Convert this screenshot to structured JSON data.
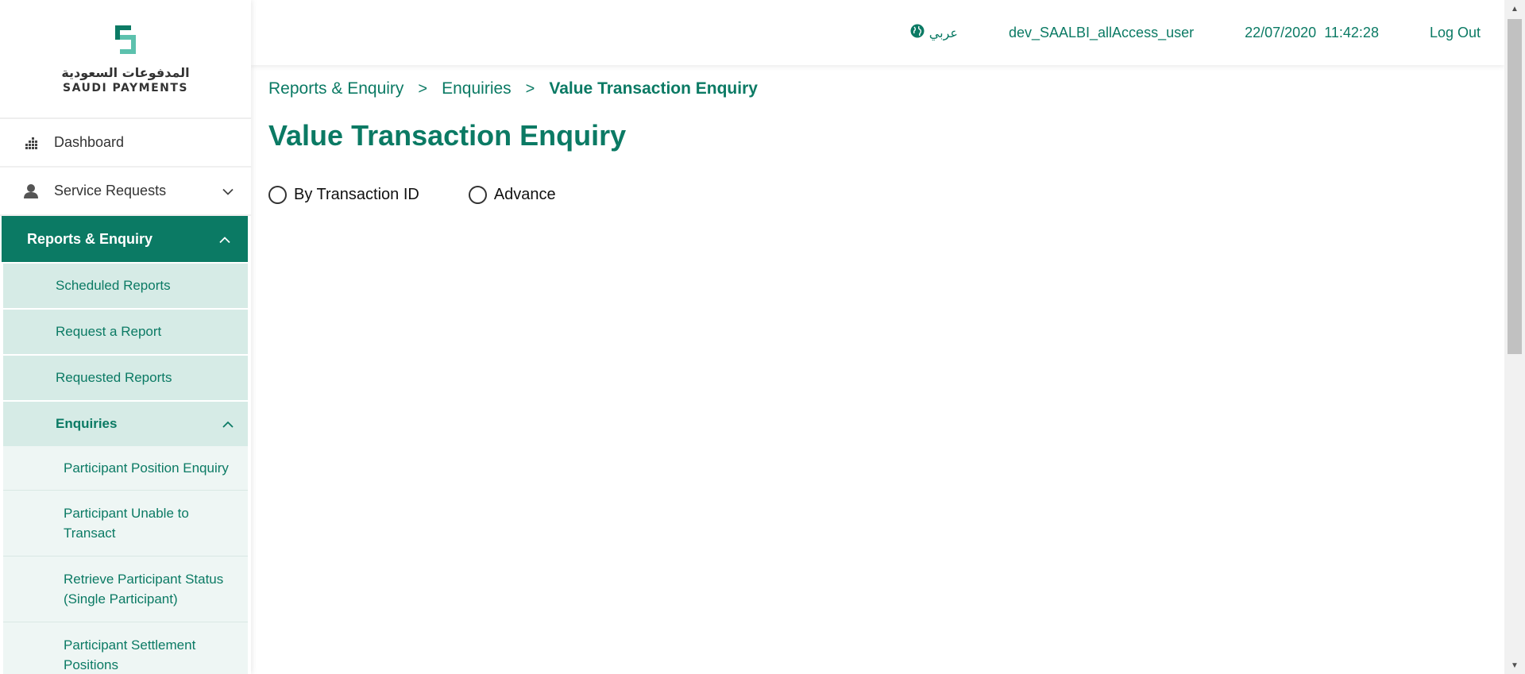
{
  "brand": {
    "name_ar": "المدفوعات السعودية",
    "name_en": "SAUDI PAYMENTS",
    "logo_icon": "saudi-payments-logo",
    "accent_color": "#0b7a64",
    "logo_light_color": "#5cc1ad"
  },
  "sidebar": {
    "items": [
      {
        "label": "Dashboard",
        "icon": "dashboard-icon"
      },
      {
        "label": "Service Requests",
        "icon": "user-icon"
      },
      {
        "label": "Reports & Enquiry"
      }
    ],
    "reports_sub": [
      {
        "label": "Scheduled Reports"
      },
      {
        "label": "Request a Report"
      },
      {
        "label": "Requested Reports"
      },
      {
        "label": "Enquiries"
      }
    ],
    "enquiries_sub": [
      {
        "label": "Participant Position Enquiry"
      },
      {
        "label": "Participant Unable to Transact"
      },
      {
        "label": "Retrieve Participant Status (Single Participant)"
      },
      {
        "label": "Participant Settlement Positions"
      }
    ]
  },
  "header": {
    "language": "عربي",
    "username": "dev_SAALBI_allAccess_user",
    "date": "22/07/2020",
    "time": "11:42:28",
    "logout": "Log Out"
  },
  "breadcrumb": {
    "items": [
      "Reports & Enquiry",
      "Enquiries"
    ],
    "separator": ">",
    "current": "Value Transaction Enquiry"
  },
  "page": {
    "title": "Value Transaction Enquiry",
    "radio_options": [
      "By Transaction ID",
      "Advance"
    ]
  }
}
